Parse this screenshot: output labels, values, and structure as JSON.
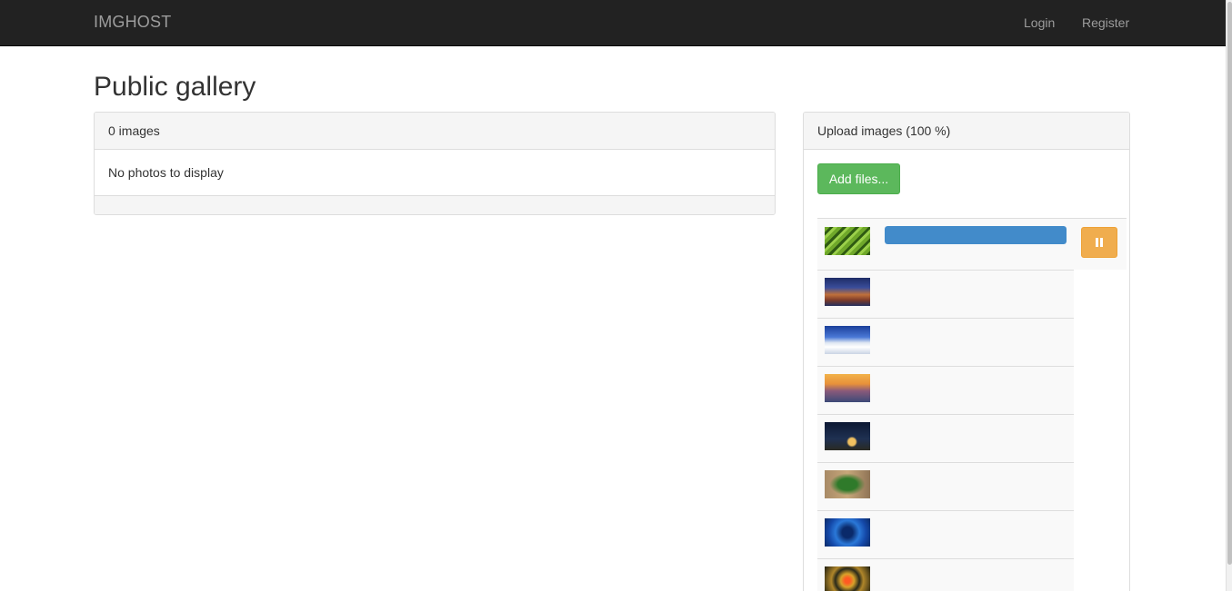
{
  "navbar": {
    "brand": "IMGHOST",
    "links": {
      "login": "Login",
      "register": "Register"
    }
  },
  "page": {
    "title": "Public gallery"
  },
  "gallery": {
    "count_label": "0 images",
    "empty_message": "No photos to display"
  },
  "upload": {
    "heading": "Upload images (100 %)",
    "add_files_label": "Add files...",
    "files": [
      {
        "thumb": "fern-leaf-thumbnail",
        "progress": 1.0,
        "uploading": true
      },
      {
        "thumb": "night-town-thumbnail"
      },
      {
        "thumb": "snowy-dunes-thumbnail"
      },
      {
        "thumb": "sunset-village-thumbnail"
      },
      {
        "thumb": "starry-night-campfire-thumbnail"
      },
      {
        "thumb": "green-snake-thumbnail"
      },
      {
        "thumb": "blue-vortex-thumbnail"
      },
      {
        "thumb": "kaleidoscope-thumbnail"
      }
    ]
  },
  "colors": {
    "navbar_bg": "#222222",
    "success": "#5cb85c",
    "warning": "#f0ad4e",
    "progress": "#428bca"
  },
  "icons": {
    "pause": "pause-icon"
  }
}
